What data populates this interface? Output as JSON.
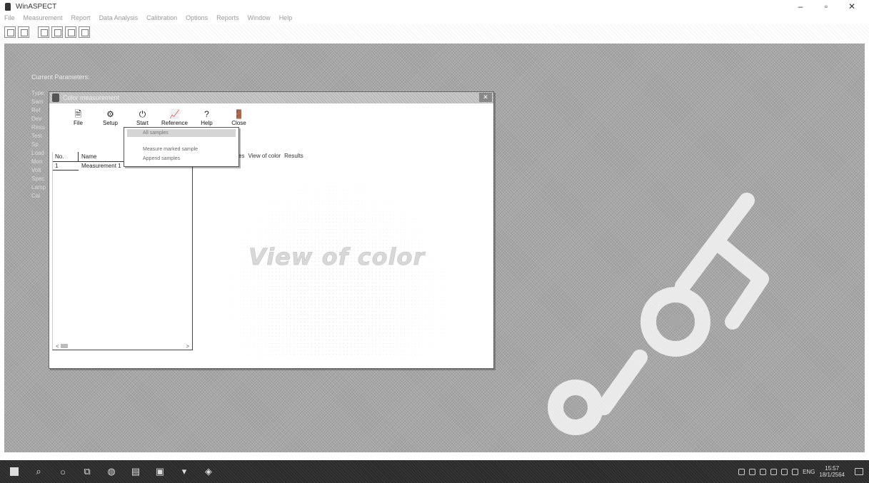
{
  "app": {
    "title": "WinASPECT",
    "menu": [
      "File",
      "Measurement",
      "Report",
      "Data Analysis",
      "Calibration",
      "Options",
      "Reports",
      "Window",
      "Help"
    ],
    "window_controls": {
      "minimize": "–",
      "maximize": "▫",
      "close": "✕"
    }
  },
  "workspace": {
    "heading": "Current Parameters:",
    "side_labels": [
      "Type:",
      "Sam",
      "Ref",
      "Dev",
      "Resu",
      "Test",
      "Sp",
      "Load",
      "Mon",
      "Volt",
      "Spec",
      "Lamp",
      "Cal"
    ]
  },
  "dialog": {
    "title": "Color measurement",
    "close_label": "✕",
    "toolbar": [
      {
        "icon": "🗎",
        "label": "File"
      },
      {
        "icon": "⚙",
        "label": "Setup"
      },
      {
        "icon": "⏻",
        "label": "Start"
      },
      {
        "icon": "📈",
        "label": "Reference"
      },
      {
        "icon": "?",
        "label": "Help"
      },
      {
        "icon": "🚪",
        "label": "Close"
      }
    ],
    "dropdown": {
      "items": [
        "All samples",
        "Measure marked sample",
        "Append samples"
      ],
      "selected": 0
    },
    "list": {
      "headers": {
        "no": "No.",
        "name": "Name"
      },
      "rows": [
        {
          "no": "1",
          "name": "Measurement 1"
        }
      ],
      "scroll_left": "<",
      "scroll_right": ">"
    },
    "tabs": [
      "es",
      "View of color",
      "Results"
    ],
    "view_label": "View of color"
  },
  "taskbar": {
    "tray": {
      "lang": "ENG",
      "time": "15:57",
      "date": "18/1/2564"
    }
  }
}
